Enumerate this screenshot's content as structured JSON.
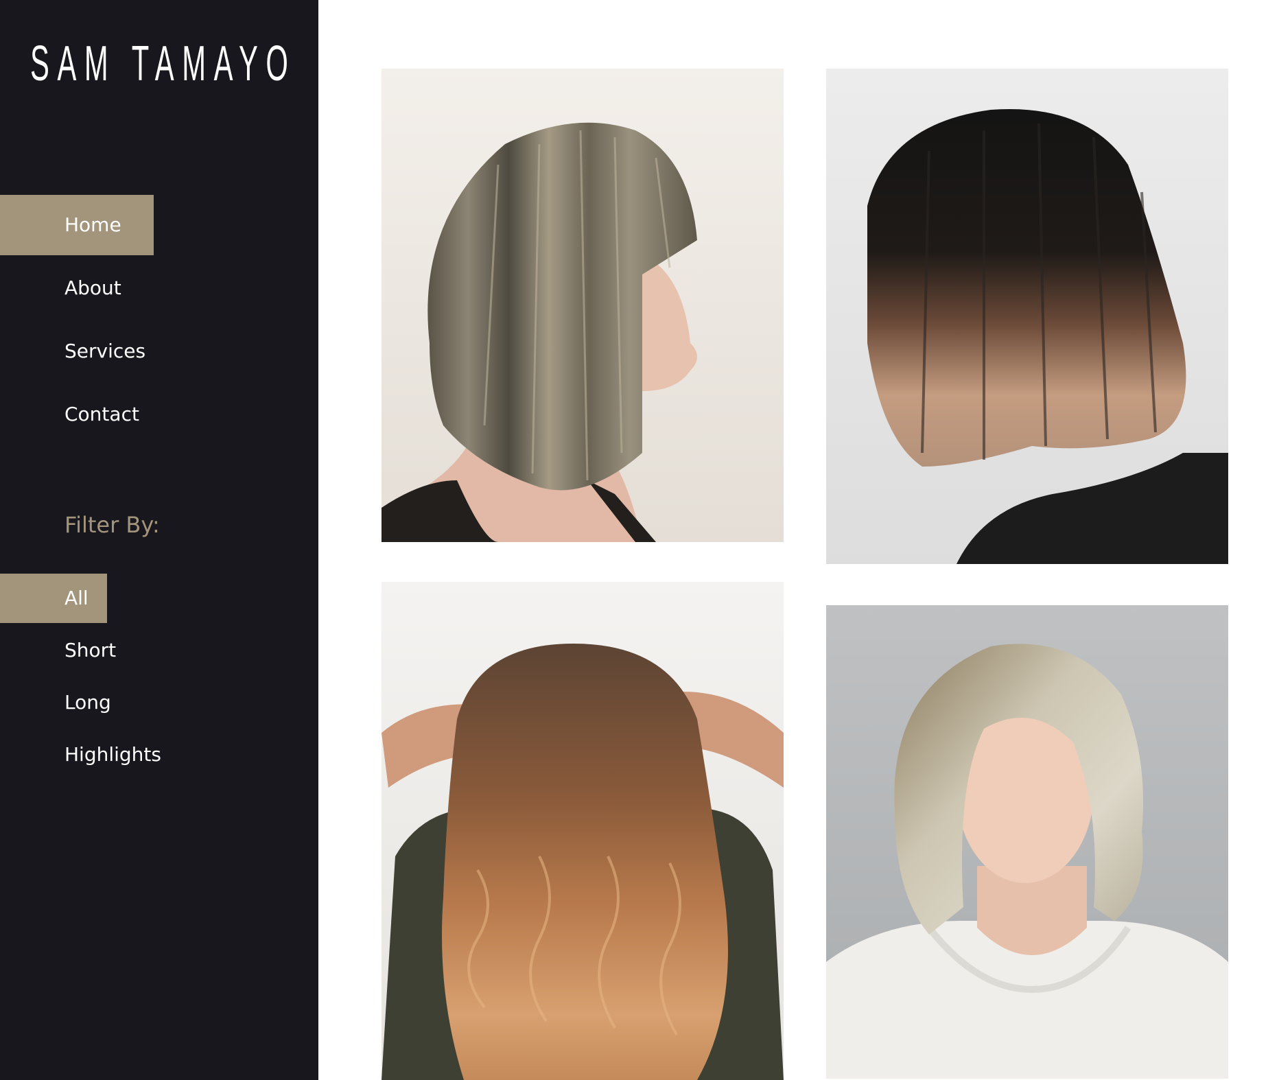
{
  "brand": {
    "logo_text": "SAM TAMAYO"
  },
  "nav": {
    "items": [
      {
        "label": "Home",
        "active": true
      },
      {
        "label": "About"
      },
      {
        "label": "Services"
      },
      {
        "label": "Contact"
      }
    ]
  },
  "filter": {
    "heading": "Filter By:",
    "options": [
      {
        "label": "All",
        "active": true
      },
      {
        "label": "Short"
      },
      {
        "label": "Long"
      },
      {
        "label": "Highlights"
      }
    ]
  },
  "colors": {
    "sidebar_bg": "#18171d",
    "accent": "#a3957c",
    "text": "#ffffff"
  },
  "gallery": {
    "photos": [
      {
        "subject": "side view of a highlighted bob with bangs"
      },
      {
        "subject": "blunt dark bob with blonde ends"
      },
      {
        "subject": "long wavy balayage from behind"
      },
      {
        "subject": "shoulder-length ash blonde layered cut"
      }
    ]
  }
}
